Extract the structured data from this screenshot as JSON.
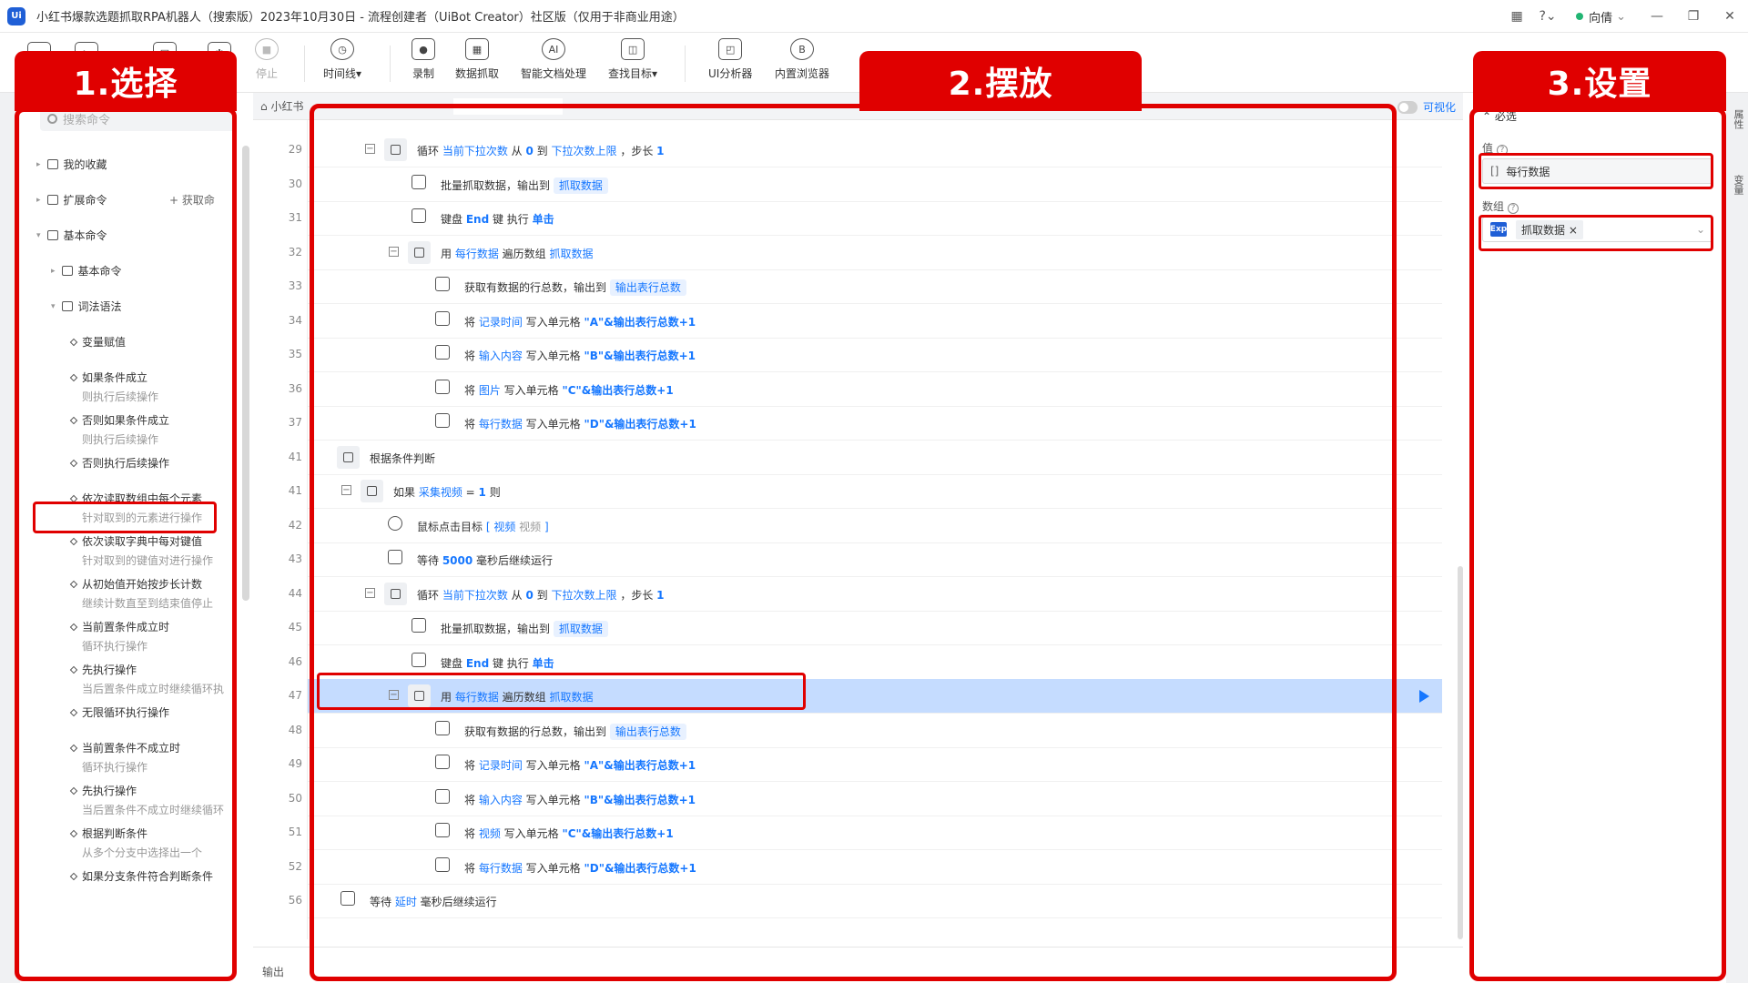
{
  "app": {
    "logo": "Ui",
    "title": "小红书爆款选题抓取RPA机器人（搜索版）2023年10月30日 - 流程创建者（UiBot Creator）社区版（仅用于非商业用途）",
    "user": "向倩",
    "icons": [
      "grid-icon",
      "help-icon",
      "minimize-icon",
      "restore-icon",
      "close-icon"
    ]
  },
  "toolbar": {
    "tools": [
      {
        "label": "停止",
        "glyph": "■",
        "disabled": true
      },
      {
        "label": "时间线▾",
        "glyph": "◷"
      },
      {
        "label": "录制",
        "glyph": "●"
      },
      {
        "label": "数据抓取",
        "glyph": "▦"
      },
      {
        "label": "智能文档处理",
        "glyph": "AI"
      },
      {
        "label": "查找目标▾",
        "glyph": "◫"
      },
      {
        "label": "UI分析器",
        "glyph": "◰"
      },
      {
        "label": "内置浏览器",
        "glyph": "B"
      }
    ]
  },
  "annotations": {
    "step1": "1.选择",
    "step2": "2.摆放",
    "step3": "3.设置"
  },
  "left_panel": {
    "search_placeholder": "搜索命令",
    "get_command": "+ 获取命",
    "tree": [
      {
        "label": "我的收藏",
        "level": 0,
        "arrow": "▸",
        "kind": "folder"
      },
      {
        "label": "扩展命令",
        "level": 0,
        "arrow": "▸",
        "kind": "folder"
      },
      {
        "label": "基本命令",
        "level": 0,
        "arrow": "▾",
        "kind": "folder"
      },
      {
        "label": "基本命令",
        "level": 1,
        "arrow": "▸",
        "kind": "folder"
      },
      {
        "label": "词法语法",
        "level": 1,
        "arrow": "▾",
        "kind": "folder"
      },
      {
        "label": "变量赋值",
        "level": 2,
        "kind": "cmd"
      },
      {
        "label": "如果条件成立",
        "sub": "则执行后续操作",
        "level": 2,
        "kind": "cmd"
      },
      {
        "label": "否则如果条件成立",
        "sub": "则执行后续操作",
        "level": 2,
        "kind": "cmd"
      },
      {
        "label": "否则执行后续操作",
        "level": 2,
        "kind": "cmd"
      },
      {
        "label": "依次读取数组中每个元素",
        "sub": "针对取到的元素进行操作",
        "level": 2,
        "kind": "cmd"
      },
      {
        "label": "依次读取字典中每对键值",
        "sub": "针对取到的键值对进行操作",
        "level": 2,
        "kind": "cmd"
      },
      {
        "label": "从初始值开始按步长计数",
        "sub": "继续计数直至到结束值停止",
        "level": 2,
        "kind": "cmd"
      },
      {
        "label": "当前置条件成立时",
        "sub": "循环执行操作",
        "level": 2,
        "kind": "cmd"
      },
      {
        "label": "先执行操作",
        "sub": "当后置条件成立时继续循环执",
        "level": 2,
        "kind": "cmd"
      },
      {
        "label": "无限循环执行操作",
        "level": 2,
        "kind": "cmd"
      },
      {
        "label": "当前置条件不成立时",
        "sub": "循环执行操作",
        "level": 2,
        "kind": "cmd"
      },
      {
        "label": "先执行操作",
        "sub": "当后置条件不成立时继续循环",
        "level": 2,
        "kind": "cmd"
      },
      {
        "label": "根据判断条件",
        "sub": "从多个分支中选择出一个",
        "level": 2,
        "kind": "cmd"
      },
      {
        "label": "如果分支条件符合判断条件",
        "level": 2,
        "kind": "cmd"
      }
    ]
  },
  "editor": {
    "tabs": [
      "小红书",
      "",
      ""
    ],
    "visual_toggle": "可视化",
    "output_label": "输出",
    "rows": [
      {
        "ln": "29",
        "indent": 2,
        "collapse": true,
        "icon": "grp",
        "parts": [
          [
            "循环 "
          ],
          [
            "当前下拉次数",
            "bl"
          ],
          [
            " 从 "
          ],
          [
            "0",
            "bl bold"
          ],
          [
            " 到 "
          ],
          [
            "下拉次数上限",
            "bl"
          ],
          [
            " ，步长 "
          ],
          [
            "1",
            "bl bold"
          ]
        ]
      },
      {
        "ln": "30",
        "indent": 3,
        "icon": "box",
        "parts": [
          [
            "批量抓取数据，输出到 "
          ],
          [
            "抓取数据",
            "chip"
          ]
        ]
      },
      {
        "ln": "31",
        "indent": 3,
        "icon": "box",
        "parts": [
          [
            "键盘 "
          ],
          [
            "End",
            "bl bold"
          ],
          [
            " 键 执行 "
          ],
          [
            "单击",
            "bl bold"
          ]
        ]
      },
      {
        "ln": "32",
        "indent": 3,
        "collapse": true,
        "icon": "grp",
        "parts": [
          [
            "用 "
          ],
          [
            "每行数据",
            "bl"
          ],
          [
            " 遍历数组 "
          ],
          [
            "抓取数据",
            "bl"
          ]
        ]
      },
      {
        "ln": "33",
        "indent": 4,
        "icon": "box",
        "parts": [
          [
            "获取有数据的行总数，输出到 "
          ],
          [
            "输出表行总数",
            "chip"
          ]
        ]
      },
      {
        "ln": "34",
        "indent": 4,
        "icon": "box",
        "parts": [
          [
            "将 "
          ],
          [
            "记录时间",
            "bl"
          ],
          [
            " 写入单元格 "
          ],
          [
            "\"A\"&输出表行总数+1",
            "bl bold"
          ]
        ]
      },
      {
        "ln": "35",
        "indent": 4,
        "icon": "box",
        "parts": [
          [
            "将 "
          ],
          [
            "输入内容",
            "bl"
          ],
          [
            " 写入单元格 "
          ],
          [
            "\"B\"&输出表行总数+1",
            "bl bold"
          ]
        ]
      },
      {
        "ln": "36",
        "indent": 4,
        "icon": "box",
        "parts": [
          [
            "将 "
          ],
          [
            "图片",
            "bl"
          ],
          [
            " 写入单元格 "
          ],
          [
            "\"C\"&输出表行总数+1",
            "bl bold"
          ]
        ]
      },
      {
        "ln": "37",
        "indent": 4,
        "icon": "box",
        "parts": [
          [
            "将 "
          ],
          [
            "每行数据",
            "bl"
          ],
          [
            " 写入单元格 "
          ],
          [
            "\"D\"&输出表行总数+1",
            "bl bold"
          ]
        ]
      },
      {
        "ln": "41",
        "indent": 0,
        "icon": "grp",
        "parts": [
          [
            "根据条件判断"
          ]
        ]
      },
      {
        "ln": "41",
        "indent": 1,
        "collapse": true,
        "icon": "grp",
        "parts": [
          [
            "如果 "
          ],
          [
            "采集视频",
            "bl"
          ],
          [
            " = "
          ],
          [
            "1",
            "bl bold"
          ],
          [
            " 则"
          ]
        ]
      },
      {
        "ln": "42",
        "indent": 2,
        "icon": "round",
        "parts": [
          [
            "鼠标点击目标 "
          ],
          [
            "[ 视频 ",
            "bl"
          ],
          [
            "视频 ",
            "sub"
          ],
          [
            " ]",
            "bl"
          ]
        ]
      },
      {
        "ln": "43",
        "indent": 2,
        "icon": "box",
        "parts": [
          [
            "等待 "
          ],
          [
            "5000",
            "bl bold"
          ],
          [
            " 毫秒后继续运行"
          ]
        ]
      },
      {
        "ln": "44",
        "indent": 2,
        "collapse": true,
        "icon": "grp",
        "parts": [
          [
            "循环 "
          ],
          [
            "当前下拉次数",
            "bl"
          ],
          [
            " 从 "
          ],
          [
            "0",
            "bl bold"
          ],
          [
            " 到 "
          ],
          [
            "下拉次数上限",
            "bl"
          ],
          [
            " ，步长 "
          ],
          [
            "1",
            "bl bold"
          ]
        ]
      },
      {
        "ln": "45",
        "indent": 3,
        "icon": "box",
        "parts": [
          [
            "批量抓取数据，输出到 "
          ],
          [
            "抓取数据",
            "chip"
          ]
        ]
      },
      {
        "ln": "46",
        "indent": 3,
        "icon": "box",
        "parts": [
          [
            "键盘 "
          ],
          [
            "End",
            "bl bold"
          ],
          [
            " 键 执行 "
          ],
          [
            "单击",
            "bl bold"
          ]
        ]
      },
      {
        "ln": "47",
        "indent": 3,
        "collapse": true,
        "icon": "grp",
        "selected": true,
        "parts": [
          [
            "用 "
          ],
          [
            "每行数据",
            "bl"
          ],
          [
            " 遍历数组 "
          ],
          [
            "抓取数据",
            "bl"
          ]
        ]
      },
      {
        "ln": "48",
        "indent": 4,
        "icon": "box",
        "parts": [
          [
            "获取有数据的行总数，输出到 "
          ],
          [
            "输出表行总数",
            "chip"
          ]
        ]
      },
      {
        "ln": "49",
        "indent": 4,
        "icon": "box",
        "parts": [
          [
            "将 "
          ],
          [
            "记录时间",
            "bl"
          ],
          [
            " 写入单元格 "
          ],
          [
            "\"A\"&输出表行总数+1",
            "bl bold"
          ]
        ]
      },
      {
        "ln": "50",
        "indent": 4,
        "icon": "box",
        "parts": [
          [
            "将 "
          ],
          [
            "输入内容",
            "bl"
          ],
          [
            " 写入单元格 "
          ],
          [
            "\"B\"&输出表行总数+1",
            "bl bold"
          ]
        ]
      },
      {
        "ln": "51",
        "indent": 4,
        "icon": "box",
        "parts": [
          [
            "将 "
          ],
          [
            "视频",
            "bl"
          ],
          [
            " 写入单元格 "
          ],
          [
            "\"C\"&输出表行总数+1",
            "bl bold"
          ]
        ]
      },
      {
        "ln": "52",
        "indent": 4,
        "icon": "box",
        "parts": [
          [
            "将 "
          ],
          [
            "每行数据",
            "bl"
          ],
          [
            " 写入单元格 "
          ],
          [
            "\"D\"&输出表行总数+1",
            "bl bold"
          ]
        ]
      },
      {
        "ln": "56",
        "indent": 0,
        "icon": "box",
        "parts": [
          [
            "等待 "
          ],
          [
            "延时",
            "bl"
          ],
          [
            " 毫秒后继续运行"
          ]
        ]
      }
    ]
  },
  "right_panel": {
    "section": "⌃ 必选",
    "value_label": "值",
    "value_text": "每行数据",
    "array_label": "数组",
    "array_badge": "Exp",
    "array_tag": "抓取数据",
    "array_tag_close": "×",
    "chevron": "⌄",
    "side_tabs": [
      "属性",
      "变量"
    ]
  }
}
